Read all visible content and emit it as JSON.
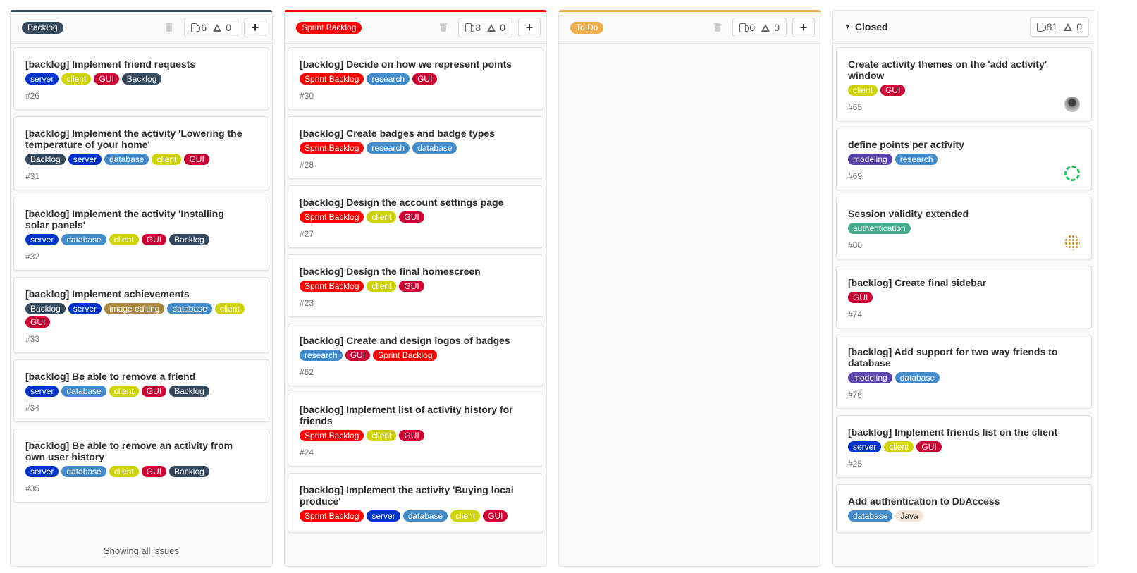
{
  "colors": {
    "backlog": "#34495e",
    "sprint_backlog": "#ff0000",
    "to_do": "#f0ad4e",
    "server": "#0033cc",
    "client": "#cfd40a",
    "gui": "#cc0033",
    "database": "#428bca",
    "research": "#428bca",
    "image_editing": "#a8893e",
    "modeling": "#5843ad",
    "authentication": "#44ad8e",
    "java": "#f6e5d6"
  },
  "columns": [
    {
      "name": "Backlog",
      "issue_count": "6",
      "weight": "0",
      "footer": "Showing all issues",
      "cards": [
        {
          "title": "[backlog] Implement friend requests",
          "labels": [
            "server",
            "client",
            "GUI",
            "Backlog"
          ],
          "number": "#26"
        },
        {
          "title": "[backlog] Implement the activity 'Lowering the temperature of your home'",
          "labels": [
            "Backlog",
            "server",
            "database",
            "client",
            "GUI"
          ],
          "number": "#31"
        },
        {
          "title": "[backlog] Implement the activity 'Installing solar panels'",
          "labels": [
            "server",
            "database",
            "client",
            "GUI",
            "Backlog"
          ],
          "number": "#32"
        },
        {
          "title": "[backlog] Implement achievements",
          "labels": [
            "Backlog",
            "server",
            "image editing",
            "database",
            "client",
            "GUI"
          ],
          "number": "#33"
        },
        {
          "title": "[backlog] Be able to remove a friend",
          "labels": [
            "server",
            "database",
            "client",
            "GUI",
            "Backlog"
          ],
          "number": "#34"
        },
        {
          "title": "[backlog] Be able to remove an activity from own user history",
          "labels": [
            "server",
            "database",
            "client",
            "GUI",
            "Backlog"
          ],
          "number": "#35"
        }
      ]
    },
    {
      "name": "Sprint Backlog",
      "issue_count": "8",
      "weight": "0",
      "cards": [
        {
          "title": "[backlog] Decide on how we represent points",
          "labels": [
            "Sprint Backlog",
            "research",
            "GUI"
          ],
          "number": "#30"
        },
        {
          "title": "[backlog] Create badges and badge types",
          "labels": [
            "Sprint Backlog",
            "research",
            "database"
          ],
          "number": "#28"
        },
        {
          "title": "[backlog] Design the account settings page",
          "labels": [
            "Sprint Backlog",
            "client",
            "GUI"
          ],
          "number": "#27"
        },
        {
          "title": "[backlog] Design the final homescreen",
          "labels": [
            "Sprint Backlog",
            "client",
            "GUI"
          ],
          "number": "#23"
        },
        {
          "title": "[backlog] Create and design logos of badges",
          "labels": [
            "research",
            "GUI",
            "Sprint Backlog"
          ],
          "number": "#62"
        },
        {
          "title": "[backlog] Implement list of activity history for friends",
          "labels": [
            "Sprint Backlog",
            "client",
            "GUI"
          ],
          "number": "#24"
        },
        {
          "title": "[backlog] Implement the activity 'Buying local produce'",
          "labels": [
            "Sprint Backlog",
            "server",
            "database",
            "client",
            "GUI"
          ],
          "number": ""
        }
      ]
    },
    {
      "name": "To Do",
      "issue_count": "0",
      "weight": "0",
      "cards": []
    },
    {
      "name": "Closed",
      "issue_count": "81",
      "weight": "0",
      "cards": [
        {
          "title": "Create activity themes on the 'add activity' window",
          "labels": [
            "client",
            "GUI"
          ],
          "number": "#65",
          "avatar": "photo"
        },
        {
          "title": "define points per activity",
          "labels": [
            "modeling",
            "research"
          ],
          "number": "#69",
          "avatar": "ring"
        },
        {
          "title": "Session validity extended",
          "labels": [
            "authentication"
          ],
          "number": "#88",
          "avatar": "dots"
        },
        {
          "title": "[backlog] Create final sidebar",
          "labels": [
            "GUI"
          ],
          "number": "#74"
        },
        {
          "title": "[backlog] Add support for two way friends to database",
          "labels": [
            "modeling",
            "database"
          ],
          "number": "#76"
        },
        {
          "title": "[backlog] Implement friends list on the client",
          "labels": [
            "server",
            "client",
            "GUI"
          ],
          "number": "#25"
        },
        {
          "title": "Add authentication to DbAccess",
          "labels": [
            "database",
            "Java"
          ],
          "number": ""
        }
      ]
    }
  ]
}
